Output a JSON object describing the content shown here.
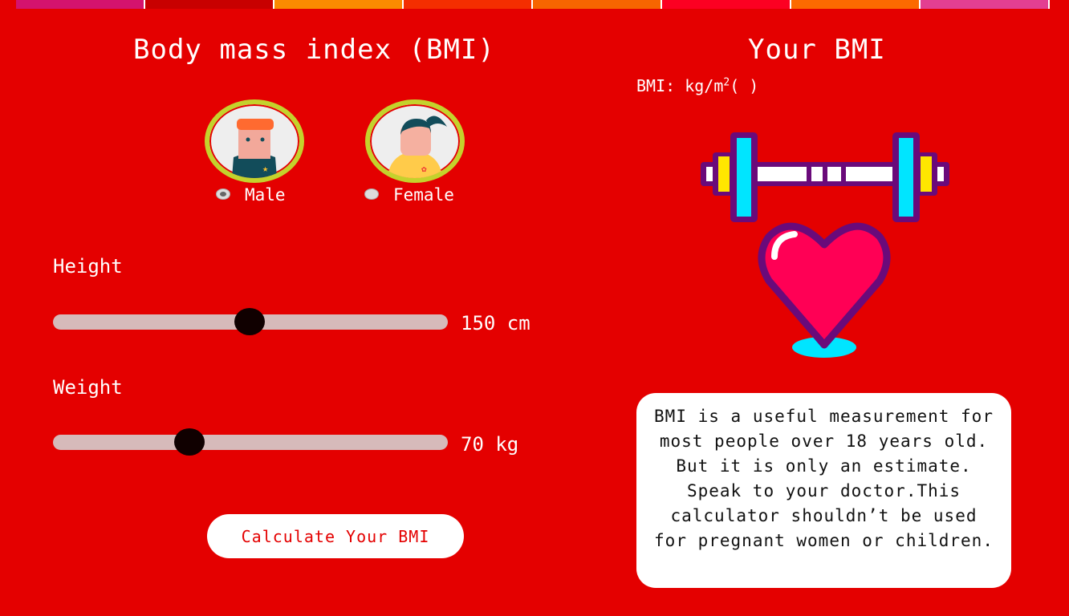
{
  "banner_colors": [
    "#d4136e",
    "#c80000",
    "#fb8a00",
    "#f42e00",
    "#f76500",
    "#fc0022",
    "#fc6a00",
    "#e33f91"
  ],
  "left": {
    "title": "Body mass index (BMI)",
    "gender": {
      "male": "Male",
      "female": "Female",
      "selected": "Male"
    },
    "height": {
      "label": "Height",
      "value_text": "150 cm",
      "fraction": 0.5
    },
    "weight": {
      "label": "Weight",
      "value_text": "70 kg",
      "fraction": 0.35
    },
    "button": "Calculate Your BMI"
  },
  "right": {
    "title": "Your BMI",
    "bmi_prefix": "BMI: kg/m",
    "bmi_sup": "2",
    "bmi_suffix": "( )",
    "note": "BMI is a useful measurement for most people over 18 years old. But it is only an estimate. Speak to your doctor.This calculator shouldn’t be used for pregnant women or children."
  }
}
